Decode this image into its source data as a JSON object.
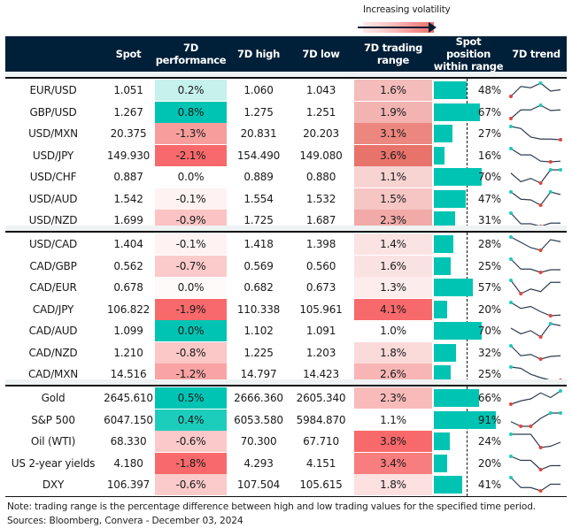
{
  "legend": {
    "label": "Increasing volatility"
  },
  "header": {
    "spot": "Spot",
    "perf_l1": "7D",
    "perf_l2": "performance",
    "high": "7D high",
    "low": "7D low",
    "range_l1": "7D trading",
    "range_l2": "range",
    "pos_l1": "Spot position",
    "pos_l2": "within range",
    "trend": "7D trend"
  },
  "colors": {
    "header_bg": "#001f38",
    "bar": "#00c4b3",
    "spark_line": "#2d3e50",
    "spark_high": "#1fc9bc",
    "spark_low": "#e2443a"
  },
  "sections": [
    {
      "rows": [
        {
          "name": "EUR/USD",
          "spot": "1.051",
          "perf": "0.2%",
          "perf_v": 0.2,
          "perf_bg": "#c6f1ec",
          "high": "1.060",
          "low": "1.043",
          "range": "1.6%",
          "range_bg": "#f4bcba",
          "pos": 48,
          "pos_label": "48%",
          "trend": [
            0.0,
            0.75,
            0.65,
            1.0,
            0.4,
            0.5
          ],
          "hi_idx": [
            3
          ],
          "lo_idx": [
            0
          ]
        },
        {
          "name": "GBP/USD",
          "spot": "1.267",
          "perf": "0.8%",
          "perf_v": 0.8,
          "perf_bg": "#00c4b3",
          "high": "1.275",
          "low": "1.251",
          "range": "1.9%",
          "range_bg": "#f2b3b1",
          "pos": 67,
          "pos_label": "67%",
          "trend": [
            0.0,
            0.65,
            0.65,
            1.0,
            0.6,
            0.65
          ],
          "hi_idx": [
            3
          ],
          "lo_idx": [
            0
          ]
        },
        {
          "name": "USD/MXN",
          "spot": "20.375",
          "perf": "-1.3%",
          "perf_v": -1.3,
          "perf_bg": "#f79e9c",
          "high": "20.831",
          "low": "20.203",
          "range": "3.1%",
          "range_bg": "#ec877f",
          "pos": 27,
          "pos_label": "27%",
          "trend": [
            1.0,
            0.85,
            0.2,
            0.05,
            0.05,
            0.0
          ],
          "hi_idx": [
            0
          ],
          "lo_idx": [
            5
          ]
        },
        {
          "name": "USD/JPY",
          "spot": "149.930",
          "perf": "-2.1%",
          "perf_v": -2.1,
          "perf_bg": "#f8696b",
          "high": "154.490",
          "low": "149.080",
          "range": "3.6%",
          "range_bg": "#e8736a",
          "pos": 16,
          "pos_label": "16%",
          "trend": [
            1.0,
            0.55,
            0.55,
            0.1,
            0.05,
            0.1
          ],
          "hi_idx": [
            0
          ],
          "lo_idx": [
            4
          ]
        },
        {
          "name": "USD/CHF",
          "spot": "0.887",
          "perf": "0.0%",
          "perf_v": 0.0,
          "perf_bg": "#ffffff",
          "high": "0.889",
          "low": "0.880",
          "range": "1.1%",
          "range_bg": "#f7d3d2",
          "pos": 70,
          "pos_label": "70%",
          "trend": [
            0.75,
            0.1,
            0.35,
            0.0,
            1.0,
            1.0
          ],
          "hi_idx": [
            4,
            5
          ],
          "lo_idx": [
            3
          ]
        },
        {
          "name": "USD/AUD",
          "spot": "1.542",
          "perf": "-0.1%",
          "perf_v": -0.1,
          "perf_bg": "#fef2f2",
          "high": "1.554",
          "low": "1.532",
          "range": "1.5%",
          "range_bg": "#f6c6c4",
          "pos": 47,
          "pos_label": "47%",
          "trend": [
            1.0,
            0.45,
            0.4,
            0.0,
            1.0,
            0.8
          ],
          "hi_idx": [
            0,
            4
          ],
          "lo_idx": [
            3
          ]
        },
        {
          "name": "USD/NZD",
          "spot": "1.699",
          "perf": "-0.9%",
          "perf_v": -0.9,
          "perf_bg": "#fbc3c3",
          "high": "1.725",
          "low": "1.687",
          "range": "2.3%",
          "range_bg": "#f1aaa7",
          "pos": 31,
          "pos_label": "31%",
          "trend": [
            1.0,
            0.2,
            0.2,
            0.0,
            0.25,
            0.25
          ],
          "hi_idx": [
            0
          ],
          "lo_idx": [
            3
          ]
        }
      ]
    },
    {
      "rows": [
        {
          "name": "USD/CAD",
          "spot": "1.404",
          "perf": "-0.1%",
          "perf_v": -0.1,
          "perf_bg": "#fef2f2",
          "high": "1.418",
          "low": "1.398",
          "range": "1.4%",
          "range_bg": "#fbe3e3",
          "pos": 28,
          "pos_label": "28%",
          "trend": [
            1.0,
            0.6,
            0.2,
            0.0,
            0.8,
            0.65
          ],
          "hi_idx": [
            0
          ],
          "lo_idx": [
            3
          ]
        },
        {
          "name": "CAD/GBP",
          "spot": "0.562",
          "perf": "-0.7%",
          "perf_v": -0.7,
          "perf_bg": "#fbcaca",
          "high": "0.569",
          "low": "0.560",
          "range": "1.6%",
          "range_bg": "#fbe2e2",
          "pos": 25,
          "pos_label": "25%",
          "trend": [
            1.0,
            0.25,
            0.25,
            0.0,
            0.2,
            0.2
          ],
          "hi_idx": [
            0
          ],
          "lo_idx": [
            3
          ]
        },
        {
          "name": "CAD/EUR",
          "spot": "0.678",
          "perf": "0.0%",
          "perf_v": 0.0,
          "perf_bg": "#fffafa",
          "high": "0.682",
          "low": "0.673",
          "range": "1.3%",
          "range_bg": "#fdecec",
          "pos": 57,
          "pos_label": "57%",
          "trend": [
            1.0,
            0.0,
            0.35,
            0.15,
            0.85,
            0.85
          ],
          "hi_idx": [
            0
          ],
          "lo_idx": [
            1
          ]
        },
        {
          "name": "CAD/JPY",
          "spot": "106.822",
          "perf": "-1.9%",
          "perf_v": -1.9,
          "perf_bg": "#f8696b",
          "high": "110.338",
          "low": "105.961",
          "range": "4.1%",
          "range_bg": "#f8696b",
          "pos": 20,
          "pos_label": "20%",
          "trend": [
            1.0,
            0.55,
            0.7,
            0.3,
            0.0,
            0.05
          ],
          "hi_idx": [
            0
          ],
          "lo_idx": [
            4
          ]
        },
        {
          "name": "CAD/AUD",
          "spot": "1.099",
          "perf": "0.0%",
          "perf_v": 0.0,
          "perf_bg": "#00c4b3",
          "high": "1.102",
          "low": "1.091",
          "range": "1.0%",
          "range_bg": "#ffffff",
          "pos": 70,
          "pos_label": "70%",
          "trend": [
            0.45,
            0.0,
            0.25,
            -0.25,
            0.8,
            0.65
          ],
          "hi_idx": [
            4
          ],
          "lo_idx": [
            3
          ]
        },
        {
          "name": "CAD/NZD",
          "spot": "1.210",
          "perf": "-0.8%",
          "perf_v": -0.8,
          "perf_bg": "#fbc7c7",
          "high": "1.225",
          "low": "1.203",
          "range": "1.8%",
          "range_bg": "#fbdada",
          "pos": 32,
          "pos_label": "32%",
          "trend": [
            1.0,
            0.25,
            0.35,
            0.0,
            0.2,
            0.25
          ],
          "hi_idx": [
            0
          ],
          "lo_idx": [
            3
          ]
        },
        {
          "name": "CAD/MXN",
          "spot": "14.516",
          "perf": "-1.2%",
          "perf_v": -1.2,
          "perf_bg": "#f9a3a4",
          "high": "14.797",
          "low": "14.423",
          "range": "2.6%",
          "range_bg": "#f7b6b5",
          "pos": 25,
          "pos_label": "25%",
          "trend": [
            1.0,
            0.9,
            0.45,
            0.2,
            0.0,
            0.0
          ],
          "hi_idx": [
            0
          ],
          "lo_idx": [
            5
          ]
        }
      ]
    },
    {
      "rows": [
        {
          "name": "Gold",
          "spot": "2645.610",
          "perf": "0.5%",
          "perf_v": 0.5,
          "perf_bg": "#00c4b3",
          "high": "2666.360",
          "low": "2605.340",
          "range": "2.3%",
          "range_bg": "#f8bbba",
          "pos": 66,
          "pos_label": "66%",
          "trend": [
            0.0,
            0.25,
            0.4,
            0.85,
            0.5,
            1.0
          ],
          "hi_idx": [
            5
          ],
          "lo_idx": [
            0
          ]
        },
        {
          "name": "S&P 500",
          "spot": "6047.150",
          "perf": "0.4%",
          "perf_v": 0.4,
          "perf_bg": "#1dcdbc",
          "high": "6053.580",
          "low": "5984.870",
          "range": "1.1%",
          "range_bg": "#ffffff",
          "pos": 91,
          "pos_label": "91%",
          "trend": [
            0.35,
            0.0,
            0.0,
            0.6,
            1.0,
            1.0
          ],
          "hi_idx": [
            4,
            5
          ],
          "lo_idx": [
            1,
            2
          ]
        },
        {
          "name": "Oil (WTI)",
          "spot": "68.330",
          "perf": "-0.6%",
          "perf_v": -0.6,
          "perf_bg": "#fbc9c9",
          "high": "70.300",
          "low": "67.710",
          "range": "3.8%",
          "range_bg": "#f8696b",
          "pos": 24,
          "pos_label": "24%",
          "trend": [
            1.0,
            1.0,
            1.0,
            0.0,
            0.1,
            0.4
          ],
          "hi_idx": [
            0
          ],
          "lo_idx": [
            3
          ]
        },
        {
          "name": "US 2-year yields",
          "spot": "4.180",
          "perf": "-1.8%",
          "perf_v": -1.8,
          "perf_bg": "#f8696b",
          "high": "4.293",
          "low": "4.151",
          "range": "3.4%",
          "range_bg": "#f87d7e",
          "pos": 20,
          "pos_label": "20%",
          "trend": [
            1.0,
            0.7,
            0.7,
            0.0,
            0.3,
            0.3
          ],
          "hi_idx": [
            0
          ],
          "lo_idx": [
            3
          ]
        },
        {
          "name": "DXY",
          "spot": "106.397",
          "perf": "-0.6%",
          "perf_v": -0.6,
          "perf_bg": "#fbcaca",
          "high": "107.504",
          "low": "105.615",
          "range": "1.8%",
          "range_bg": "#fde0e0",
          "pos": 41,
          "pos_label": "41%",
          "trend": [
            1.0,
            0.25,
            0.25,
            0.0,
            0.5,
            0.5
          ],
          "hi_idx": [
            0
          ],
          "lo_idx": [
            3
          ]
        }
      ]
    }
  ],
  "footer": {
    "note": "Note: trading range is the percentage difference between high and low trading values for the specified time period.",
    "sources": "Sources: Bloomberg, Convera - December 03, 2024"
  }
}
